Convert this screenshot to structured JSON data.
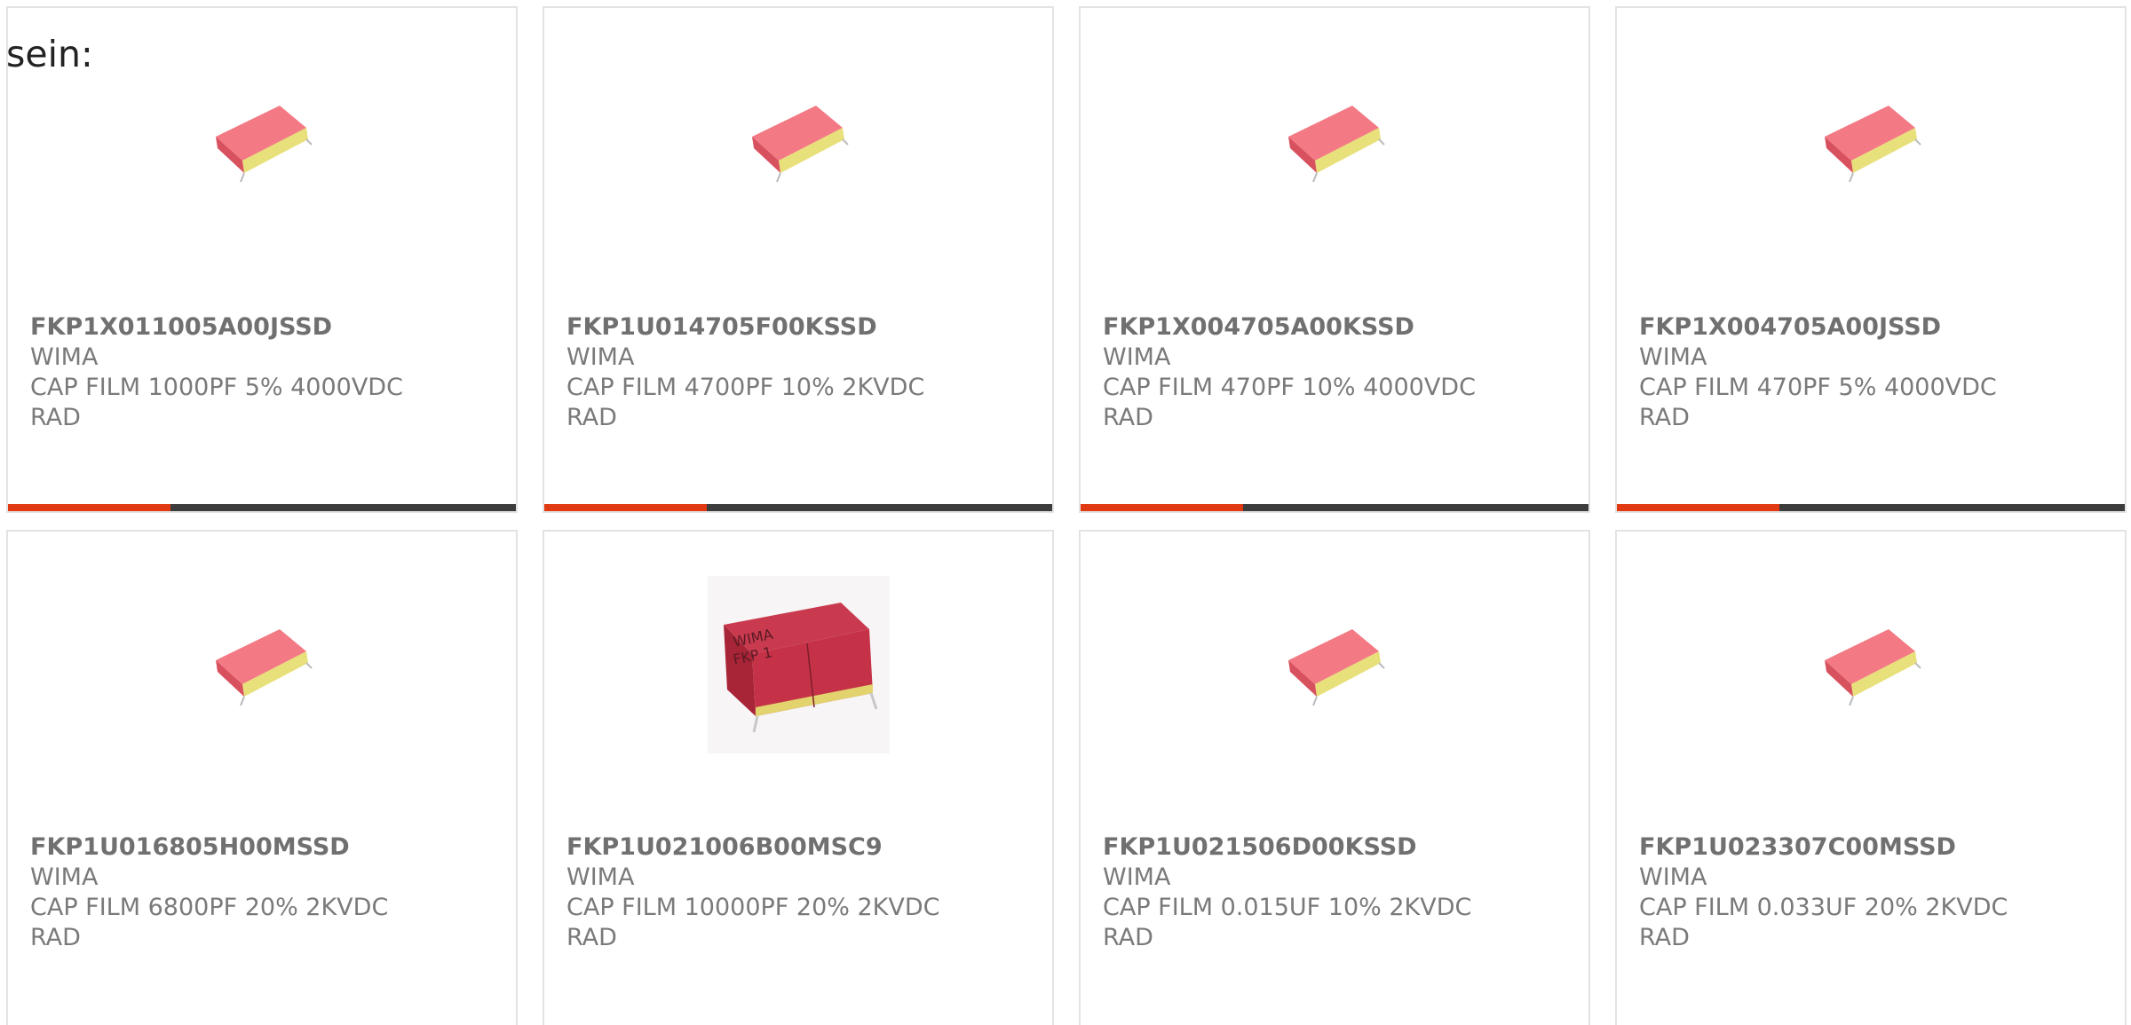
{
  "intro": {
    "text": "sein:"
  },
  "colors": {
    "accent": "#e13a12",
    "bar": "#3c3c3c",
    "capacitor_red": "#f07080",
    "capacitor_yellow": "#e9e07a"
  },
  "products": [
    {
      "part_number": "FKP1X011005A00JSSD",
      "manufacturer": "WIMA",
      "description": "CAP FILM 1000PF 5% 4000VDC",
      "package": "RAD",
      "image_icon": "capacitor-icon",
      "progress": 0.32
    },
    {
      "part_number": "FKP1U014705F00KSSD",
      "manufacturer": "WIMA",
      "description": "CAP FILM 4700PF 10% 2KVDC",
      "package": "RAD",
      "image_icon": "capacitor-icon",
      "progress": 0.32
    },
    {
      "part_number": "FKP1X004705A00KSSD",
      "manufacturer": "WIMA",
      "description": "CAP FILM 470PF 10% 4000VDC",
      "package": "RAD",
      "image_icon": "capacitor-icon",
      "progress": 0.32
    },
    {
      "part_number": "FKP1X004705A00JSSD",
      "manufacturer": "WIMA",
      "description": "CAP FILM 470PF 5% 4000VDC",
      "package": "RAD",
      "image_icon": "capacitor-icon",
      "progress": 0.32
    },
    {
      "part_number": "FKP1U016805H00MSSD",
      "manufacturer": "WIMA",
      "description": "CAP FILM 6800PF 20% 2KVDC",
      "package": "RAD",
      "image_icon": "capacitor-icon"
    },
    {
      "part_number": "FKP1U021006B00MSC9",
      "manufacturer": "WIMA",
      "description": "CAP FILM 10000PF 20% 2KVDC",
      "package": "RAD",
      "image_icon": "wima-capacitor-photo",
      "image_label": "WIMA FKP 1"
    },
    {
      "part_number": "FKP1U021506D00KSSD",
      "manufacturer": "WIMA",
      "description": "CAP FILM 0.015UF 10% 2KVDC",
      "package": "RAD",
      "image_icon": "capacitor-icon"
    },
    {
      "part_number": "FKP1U023307C00MSSD",
      "manufacturer": "WIMA",
      "description": "CAP FILM 0.033UF 20% 2KVDC",
      "package": "RAD",
      "image_icon": "capacitor-icon"
    }
  ]
}
